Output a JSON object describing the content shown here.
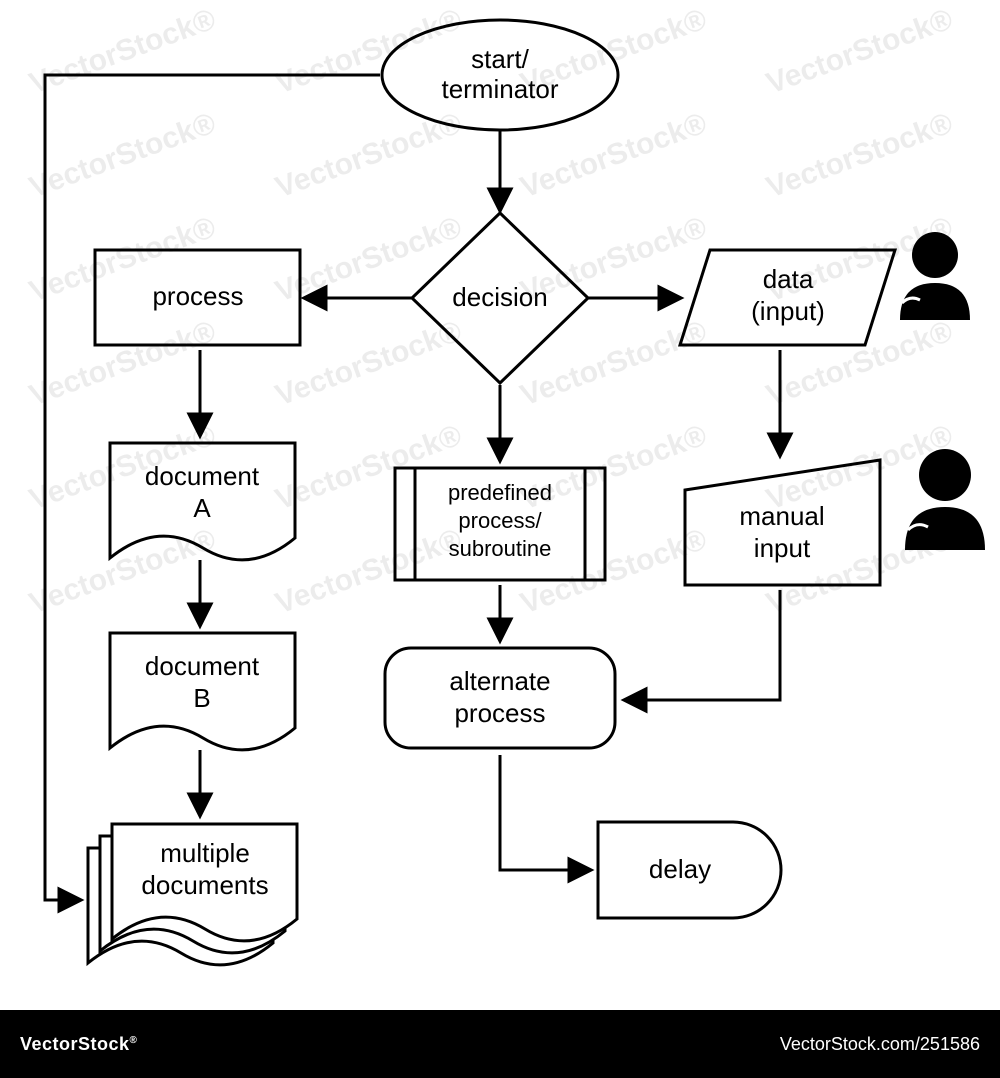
{
  "nodes": {
    "start": {
      "line1": "start/",
      "line2": "terminator"
    },
    "process": "process",
    "decision": "decision",
    "data": {
      "line1": "data",
      "line2": "(input)"
    },
    "documentA": {
      "line1": "document",
      "line2": "A"
    },
    "documentB": {
      "line1": "document",
      "line2": "B"
    },
    "multiDoc": {
      "line1": "multiple",
      "line2": "documents"
    },
    "predef": {
      "line1": "predefined",
      "line2": "process/",
      "line3": "subroutine"
    },
    "manual": {
      "line1": "manual",
      "line2": "input"
    },
    "altproc": {
      "line1": "alternate",
      "line2": "process"
    },
    "delay": "delay"
  },
  "footer": {
    "brand": "VectorStock",
    "tm": "®",
    "id": "251586",
    "site": "VectorStock.com"
  },
  "watermark": "VectorStock®"
}
